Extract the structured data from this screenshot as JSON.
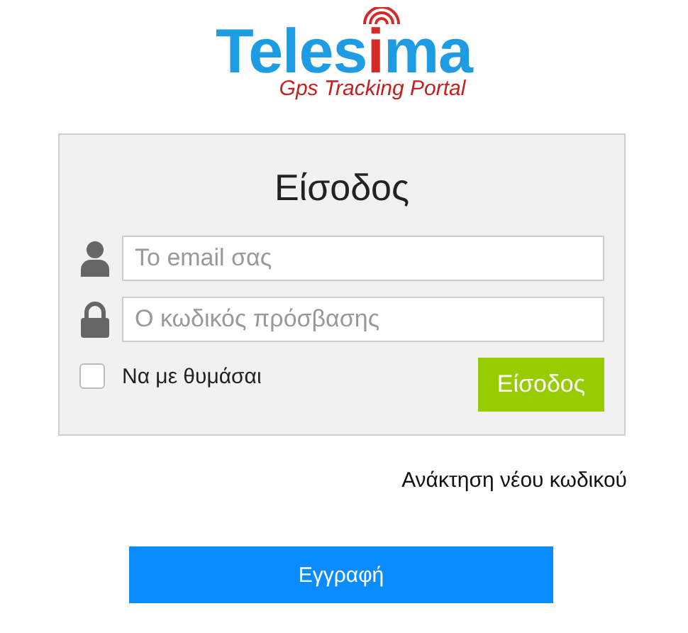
{
  "logo": {
    "parts": [
      {
        "text": "Teles",
        "color": "#1d9be3"
      },
      {
        "text": "i",
        "color": "#d42a2a"
      },
      {
        "text": "ma",
        "color": "#1d9be3"
      }
    ],
    "tagline": "Gps Tracking Portal"
  },
  "login": {
    "title": "Είσοδος",
    "email": {
      "placeholder": "Το email σας"
    },
    "password": {
      "placeholder": "Ο κωδικός πρόσβασης"
    },
    "remember": {
      "label": "Να με θυμάσαι",
      "checked": false
    },
    "submit": "Είσοδος"
  },
  "recover_link": "Ανάκτηση νέου κωδικού",
  "register_button": "Εγγραφή"
}
